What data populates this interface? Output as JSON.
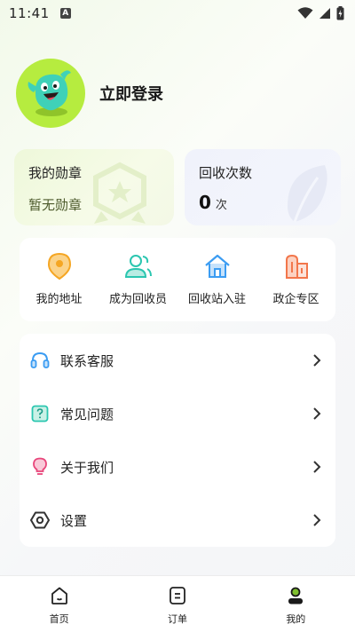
{
  "status": {
    "time": "11:41",
    "notif_letter": "A"
  },
  "profile": {
    "login_label": "立即登录"
  },
  "stats": {
    "medal": {
      "title": "我的勋章",
      "subtitle": "暂无勋章"
    },
    "recycle": {
      "title": "回收次数",
      "count": "0",
      "unit": "次"
    }
  },
  "quick_actions": [
    {
      "label": "我的地址",
      "icon": "location-pin-icon"
    },
    {
      "label": "成为回收员",
      "icon": "users-icon"
    },
    {
      "label": "回收站入驻",
      "icon": "home-icon"
    },
    {
      "label": "政企专区",
      "icon": "buildings-icon"
    }
  ],
  "menu": [
    {
      "label": "联系客服",
      "icon": "headset-icon"
    },
    {
      "label": "常见问题",
      "icon": "question-icon"
    },
    {
      "label": "关于我们",
      "icon": "lightbulb-icon"
    },
    {
      "label": "设置",
      "icon": "settings-hex-icon"
    }
  ],
  "bottom_nav": [
    {
      "label": "首页",
      "icon": "home-nav-icon"
    },
    {
      "label": "订单",
      "icon": "order-icon"
    },
    {
      "label": "我的",
      "icon": "profile-icon"
    }
  ],
  "colors": {
    "accent_green": "#b6ec3f",
    "orange": "#f5a623",
    "teal": "#2bc6b0",
    "blue": "#3b9cf2",
    "coral": "#f2764b",
    "pink": "#e8457a"
  }
}
